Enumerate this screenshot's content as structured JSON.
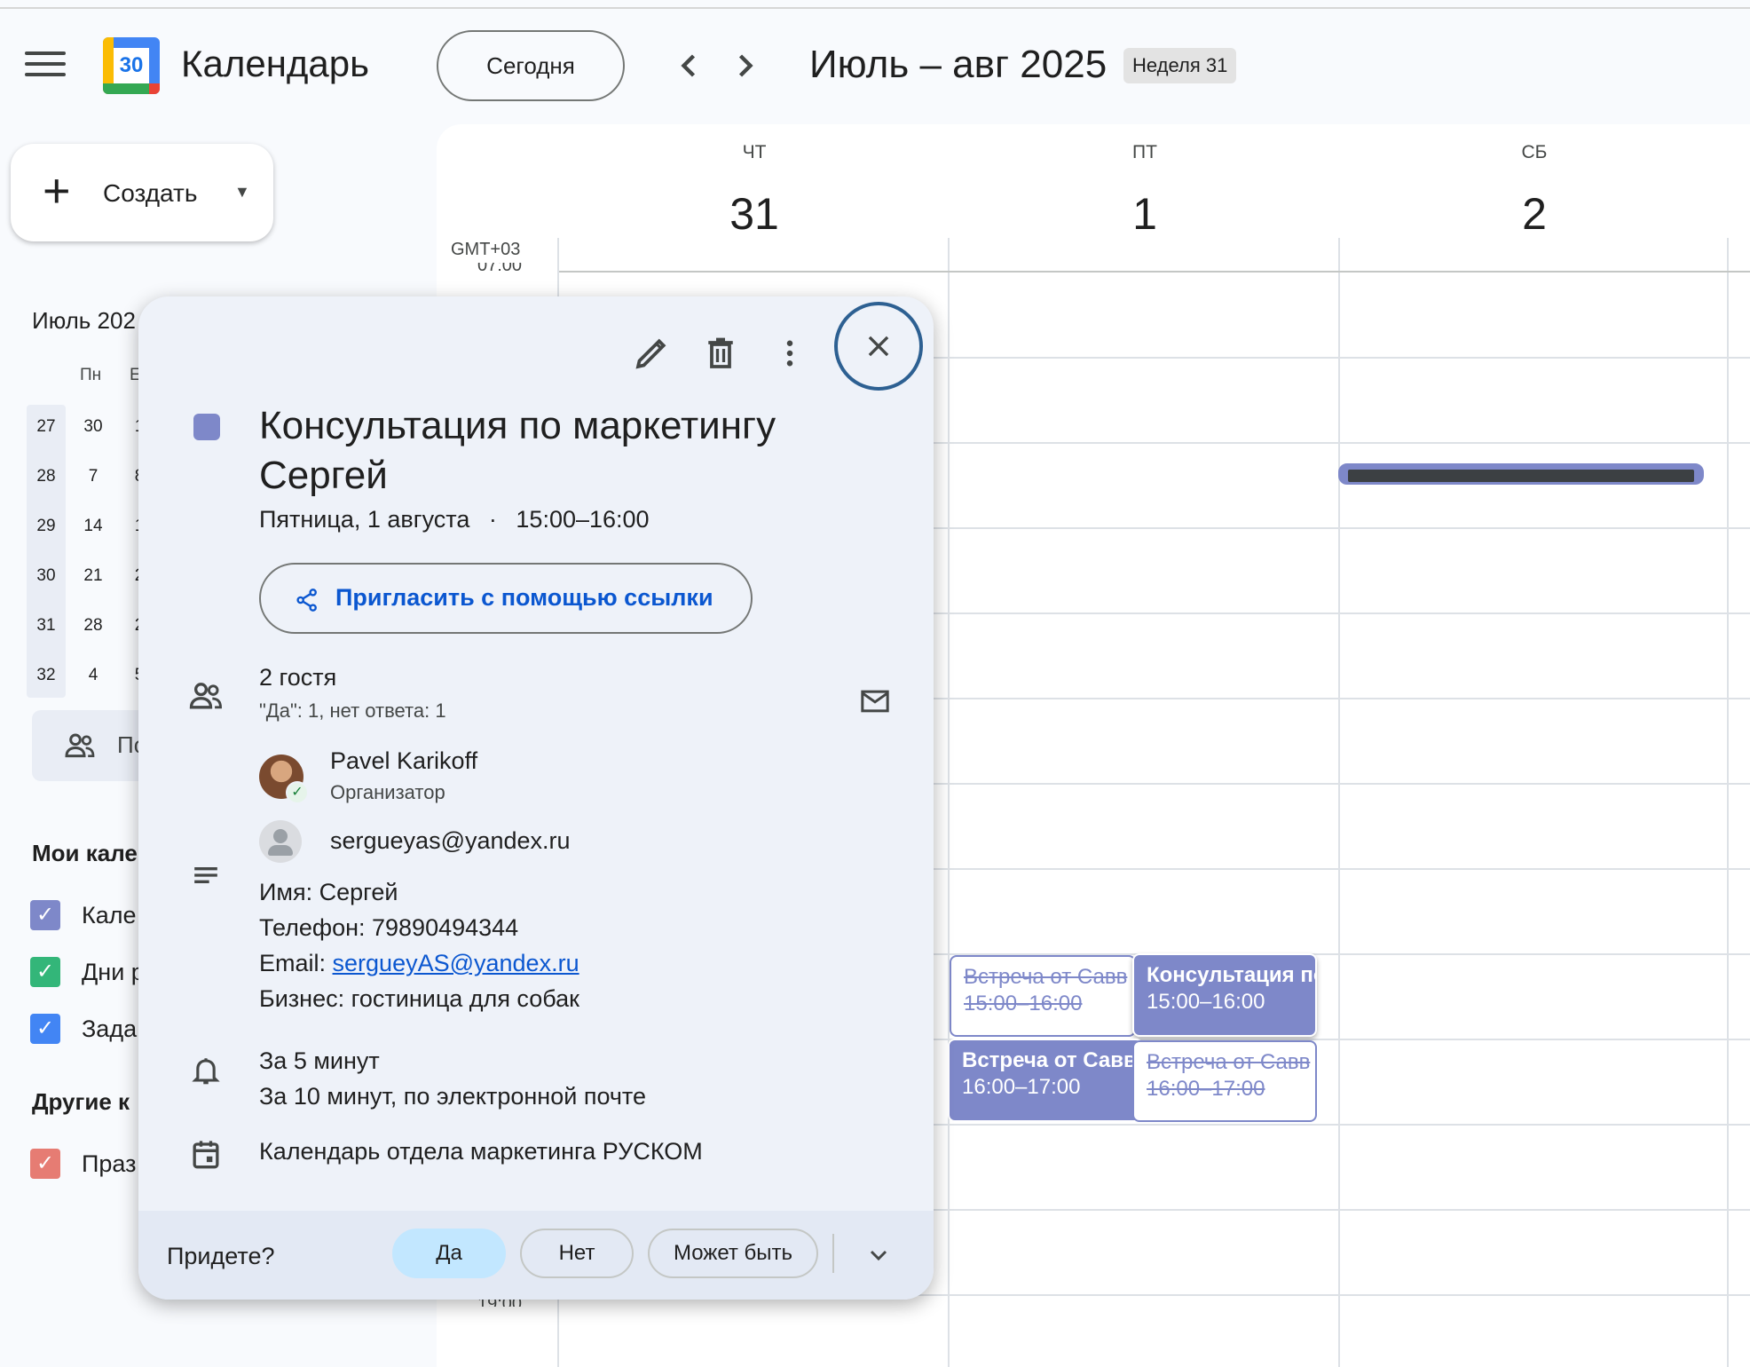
{
  "header": {
    "app_title": "Календарь",
    "logo_day": "30",
    "today_label": "Сегодня",
    "range_title": "Июль – авг 2025",
    "week_badge": "Неделя 31"
  },
  "sidebar": {
    "create_label": "Создать",
    "mini_calendar": {
      "title": "Июль 202",
      "dow_visible": [
        "Пн",
        "Е"
      ],
      "week_numbers": [
        "27",
        "28",
        "29",
        "30",
        "31",
        "32"
      ],
      "col_mon": [
        "30",
        "7",
        "14",
        "21",
        "28",
        "4"
      ],
      "col_tue_partial": [
        "1",
        "8",
        "1",
        "2",
        "2",
        "5"
      ]
    },
    "people_label": "По",
    "my_calendars_title": "Мои кале",
    "my_calendars": [
      {
        "label": "Кале",
        "color": "#7e88c9"
      },
      {
        "label": "Дни р",
        "color": "#33b679"
      },
      {
        "label": "Зада",
        "color": "#4285f4"
      }
    ],
    "other_calendars_title": "Другие к",
    "other_calendars": [
      {
        "label": "Праз",
        "color": "#e67c73"
      }
    ]
  },
  "grid": {
    "timezone": "GMT+03",
    "hour_top": "07:00",
    "hour_bottom": "19:00",
    "days": [
      {
        "dow": "ЧТ",
        "num": "31"
      },
      {
        "dow": "ПТ",
        "num": "1"
      },
      {
        "dow": "СБ",
        "num": "2"
      }
    ],
    "events": [
      {
        "title": "Встреча от Савв",
        "time": "15:00–16:00",
        "style": "outline-declined"
      },
      {
        "title": "Консультация по",
        "time": "15:00–16:00",
        "style": "solid"
      },
      {
        "title": "Встреча от Савв",
        "time": "16:00–17:00",
        "style": "solid"
      },
      {
        "title": "Встреча от Савв",
        "time": "16:00–17:00",
        "style": "outline-declined"
      }
    ]
  },
  "popup": {
    "title": "Консультация по маркетингу Сергей",
    "date": "Пятница, 1 августа",
    "dot": "·",
    "time": "15:00–16:00",
    "invite_label": "Пригласить с помощью ссылки",
    "guests_count": "2 гостя",
    "guests_summary": "\"Да\": 1, нет ответа: 1",
    "guests": [
      {
        "name": "Pavel Karikoff",
        "role": "Организатор"
      },
      {
        "name": "sergueyas@yandex.ru",
        "role": ""
      }
    ],
    "description": {
      "name_line": "Имя: Сергей",
      "phone_line": "Телефон: 79890494344",
      "email_prefix": "Email: ",
      "email_link": "sergueyAS@yandex.ru",
      "business_line": "Бизнес: гостиница для собак"
    },
    "reminders": [
      "За 5 минут",
      "За 10 минут, по электронной почте"
    ],
    "calendar_name": "Календарь отдела маркетинга РУСКОМ",
    "footer": {
      "question": "Придете?",
      "yes": "Да",
      "no": "Нет",
      "maybe": "Может быть",
      "selected": "yes"
    }
  }
}
